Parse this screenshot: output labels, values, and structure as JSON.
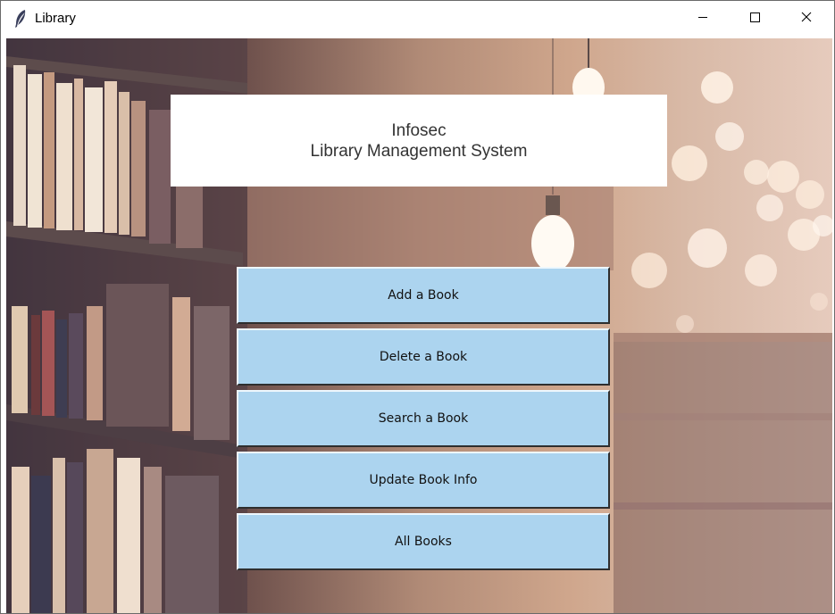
{
  "window": {
    "title": "Library",
    "app_icon": "feather-icon",
    "controls": {
      "minimize_icon": "minimize-icon",
      "maximize_icon": "maximize-icon",
      "close_icon": "close-icon"
    }
  },
  "heading": {
    "line1": "Infosec",
    "line2": "Library Management System"
  },
  "menu": {
    "buttons": [
      {
        "label": "Add a Book"
      },
      {
        "label": "Delete a Book"
      },
      {
        "label": "Search a Book"
      },
      {
        "label": "Update Book Info"
      },
      {
        "label": "All Books"
      }
    ]
  },
  "colors": {
    "button_bg": "#acd4ef",
    "heading_bg": "#ffffff"
  },
  "background_image": "library-bookshelves-photo"
}
